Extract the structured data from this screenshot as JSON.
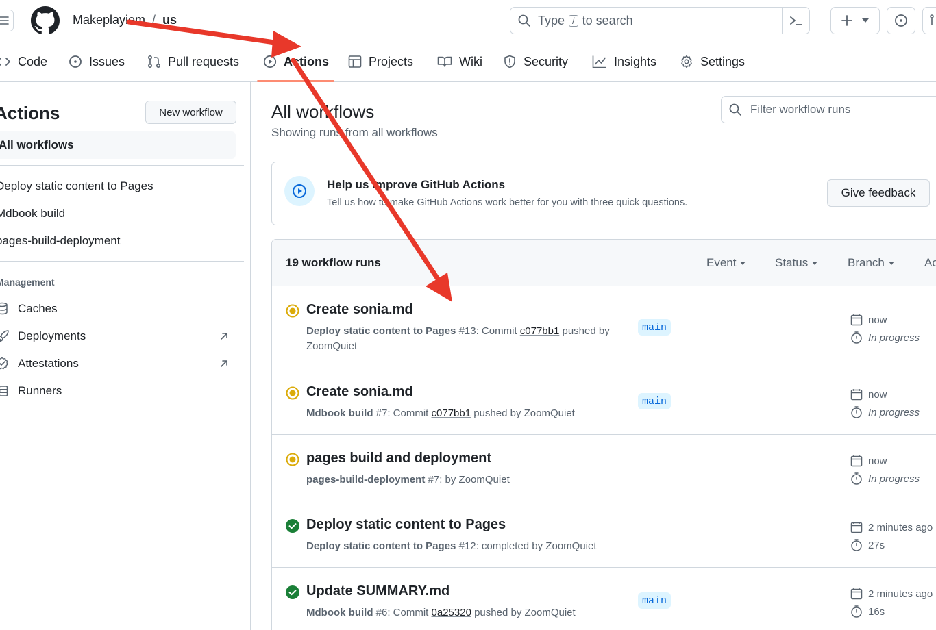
{
  "header": {
    "owner": "Makeplayiem",
    "separator": "/",
    "repo": "us",
    "search_prefix": "Type",
    "search_key": "/",
    "search_suffix": "to search"
  },
  "nav": {
    "items": [
      {
        "label": "Code",
        "icon": "code-icon"
      },
      {
        "label": "Issues",
        "icon": "issue-icon"
      },
      {
        "label": "Pull requests",
        "icon": "pull-request-icon"
      },
      {
        "label": "Actions",
        "icon": "play-icon",
        "active": true
      },
      {
        "label": "Projects",
        "icon": "table-icon"
      },
      {
        "label": "Wiki",
        "icon": "book-icon"
      },
      {
        "label": "Security",
        "icon": "shield-icon"
      },
      {
        "label": "Insights",
        "icon": "graph-icon"
      },
      {
        "label": "Settings",
        "icon": "gear-icon"
      }
    ]
  },
  "sidebar": {
    "title": "Actions",
    "new_workflow": "New workflow",
    "all_workflows": "All workflows",
    "workflows": [
      "Deploy static content to Pages",
      "Mdbook build",
      "pages-build-deployment"
    ],
    "management_heading": "Management",
    "management": [
      {
        "label": "Caches",
        "icon": "database-icon"
      },
      {
        "label": "Deployments",
        "icon": "rocket-icon",
        "external": true
      },
      {
        "label": "Attestations",
        "icon": "verified-icon",
        "external": true
      },
      {
        "label": "Runners",
        "icon": "server-icon"
      }
    ]
  },
  "main": {
    "title": "All workflows",
    "subtitle": "Showing runs from all workflows",
    "filter_placeholder": "Filter workflow runs",
    "banner": {
      "title": "Help us improve GitHub Actions",
      "text": "Tell us how to make GitHub Actions work better for you with three quick questions.",
      "button": "Give feedback"
    },
    "runs_count": "19 workflow runs",
    "filters": [
      "Event",
      "Status",
      "Branch",
      "Ac"
    ],
    "runs": [
      {
        "status": "in-progress",
        "title": "Create sonia.md",
        "workflow": "Deploy static content to Pages",
        "meta_mid": "#13: Commit",
        "commit": "c077bb1",
        "meta_end": "pushed by ZoomQuiet",
        "branch": "main",
        "time": "now",
        "duration": "In progress"
      },
      {
        "status": "in-progress",
        "title": "Create sonia.md",
        "workflow": "Mdbook build",
        "meta_mid": "#7: Commit",
        "commit": "c077bb1",
        "meta_end": "pushed by ZoomQuiet",
        "branch": "main",
        "time": "now",
        "duration": "In progress"
      },
      {
        "status": "in-progress",
        "title": "pages build and deployment",
        "workflow": "pages-build-deployment",
        "meta_mid": "#7: by ZoomQuiet",
        "commit": "",
        "meta_end": "",
        "branch": "",
        "time": "now",
        "duration": "In progress"
      },
      {
        "status": "success",
        "title": "Deploy static content to Pages",
        "workflow": "Deploy static content to Pages",
        "meta_mid": "#12: completed by ZoomQuiet",
        "commit": "",
        "meta_end": "",
        "branch": "",
        "time": "2 minutes ago",
        "duration": "27s"
      },
      {
        "status": "success",
        "title": "Update SUMMARY.md",
        "workflow": "Mdbook build",
        "meta_mid": "#6: Commit",
        "commit": "0a25320",
        "meta_end": "pushed by ZoomQuiet",
        "branch": "main",
        "time": "2 minutes ago",
        "duration": "16s"
      }
    ]
  },
  "colors": {
    "accent": "#0969da",
    "success": "#1a7f37",
    "in_progress": "#dbab0a",
    "annotation_arrow": "#e8382a",
    "nav_underline": "#fd8c73"
  }
}
